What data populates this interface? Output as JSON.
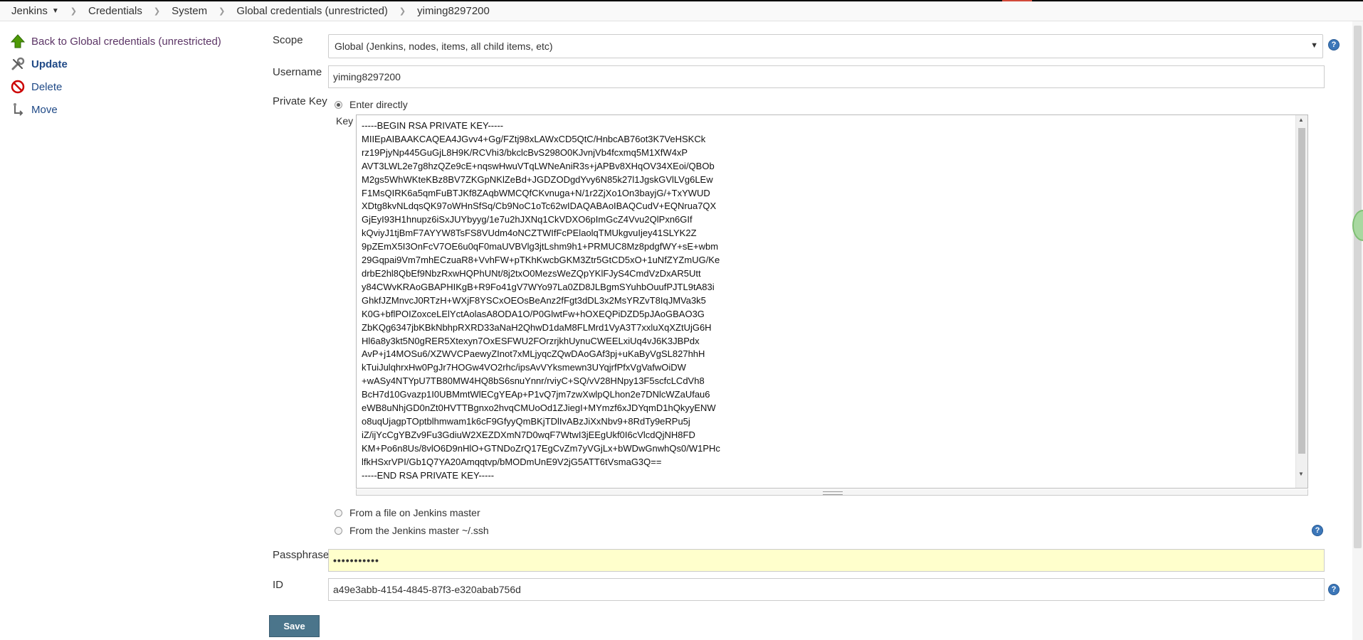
{
  "breadcrumbs": {
    "items": [
      "Jenkins",
      "Credentials",
      "System",
      "Global credentials (unrestricted)",
      "yiming8297200"
    ]
  },
  "side_panel": {
    "back_label": "Back to Global credentials (unrestricted)",
    "update_label": "Update",
    "delete_label": "Delete",
    "move_label": "Move"
  },
  "form": {
    "scope_label": "Scope",
    "scope_value": "Global (Jenkins, nodes, items, all child items, etc)",
    "username_label": "Username",
    "username_value": "yiming8297200",
    "private_key_label": "Private Key",
    "option_enter_directly": "Enter directly",
    "key_label": "Key",
    "key_value": "-----BEGIN RSA PRIVATE KEY-----\nMIIEpAIBAAKCAQEA4JGvv4+Gg/FZtj98xLAWxCD5QtC/HnbcAB76ot3K7VeHSKCk\nrz19PjyNp445GuGjL8H9K/RCVhi3/bkclcBvS298O0KJvnjVb4fcxmq5M1XfW4xP\nAVT3LWL2e7g8hzQZe9cE+nqswHwuVTqLWNeAniR3s+jAPBv8XHqOV34XEoi/QBOb\nM2gs5WhWKteKBz8BV7ZKGpNKlZeBd+JGDZODgdYvy6N85k27l1JgskGVlLVg6LEw\nF1MsQIRK6a5qmFuBTJKf8ZAqbWMCQfCKvnuga+N/1r2ZjXo1On3bayjG/+TxYWUD\nXDtg8kvNLdqsQK97oWHnSfSq/Cb9NoC1oTc62wIDAQABAoIBAQCudV+EQNrua7QX\nGjEyI93H1hnupz6iSxJUYbyyg/1e7u2hJXNq1CkVDXO6pImGcZ4Vvu2QlPxn6GIf\nkQviyJ1tjBmF7AYYW8TsFS8VUdm4oNCZTWIfFcPElaolqTMUkgvuIjey41SLYK2Z\n9pZEmX5I3OnFcV7OE6u0qF0maUVBVlg3jtLshm9h1+PRMUC8Mz8pdgfWY+sE+wbm\n29Gqpai9Vm7mhECzuaR8+VvhFW+pTKhKwcbGKM3Ztr5GtCD5xO+1uNfZYZmUG/Ke\ndrbE2hl8QbEf9NbzRxwHQPhUNt/8j2txO0MezsWeZQpYKlFJyS4CmdVzDxAR5Utt\ny84CWvKRAoGBAPHIKgB+R9Fo41gV7WYo97La0ZD8JLBgmSYuhbOuufPJTL9tA83i\nGhkfJZMnvcJ0RTzH+WXjF8YSCxOEOsBeAnz2fFgt3dDL3x2MsYRZvT8IqJMVa3k5\nK0G+bflPOIZoxceLElYctAolasA8ODA1O/P0GlwtFw+hOXEQPiDZD5pJAoGBAO3G\nZbKQg6347jbKBkNbhpRXRD33aNaH2QhwD1daM8FLMrd1VyA3T7xxluXqXZtUjG6H\nHl6a8y3kt5N0gRER5Xtexyn7OxESFWU2FOrzrjkhUynuCWEELxiUq4vJ6K3JBPdx\nAvP+j14MOSu6/XZWVCPaewyZInot7xMLjyqcZQwDAoGAf3pj+uKaByVgSL827hhH\nkTuiJulqhrxHw0PgJr7HOGw4VO2rhc/ipsAvVYksmewn3UYqjrfPfxVgVafwOiDW\n+wASy4NTYpU7TB80MW4HQ8bS6snuYnnr/rviyC+SQ/vV28HNpy13F5scfcLCdVh8\nBcH7d10Gvazp1I0UBMmtWlECgYEAp+P1vQ7jm7zwXwlpQLhon2e7DNlcWZaUfau6\neWB8uNhjGD0nZt0HVTTBgnxo2hvqCMUoOd1ZJiegI+MYmzf6xJDYqmD1hQkyyENW\no8uqUjagpTOptblhmwam1k6cF9GfyyQmBKjTDlIvABzJiXxNbv9+8RdTy9eRPu5j\niZ/ijYcCgYBZv9Fu3GdiuW2XEZDXmN7D0wqF7WtwI3jEEgUkf0I6cVlcdQjNH8FD\nKM+Po6n8Us/8vlO6D9nHlO+GTNDoZrQ17EgCvZm7yVGjLx+bWDwGnwhQs0/W1PHc\nlfkHSxrVPI/Gb1Q7YA20Amqqtvp/bMODmUnE9V2jG5ATT6tVsmaG3Q==\n-----END RSA PRIVATE KEY-----",
    "option_file_on_master": "From a file on Jenkins master",
    "option_master_ssh": "From the Jenkins master ~/.ssh",
    "passphrase_label": "Passphrase",
    "passphrase_value": "•••••••••••",
    "id_label": "ID",
    "id_value": "a49e3abb-4154-4845-87f3-e320abab756d",
    "save_label": "Save"
  },
  "icons": {
    "back": "green-up-arrow-icon",
    "update": "wrench-screwdriver-icon",
    "delete": "no-entry-icon",
    "move": "move-icon",
    "help": "help-icon",
    "caret": "chevron-down-icon",
    "separator": "chevron-right-icon"
  },
  "colors": {
    "save_button": "#4b758b",
    "passphrase_background": "#ffffcc",
    "help_icon": "#3c77b9",
    "link": "#5c3566"
  }
}
